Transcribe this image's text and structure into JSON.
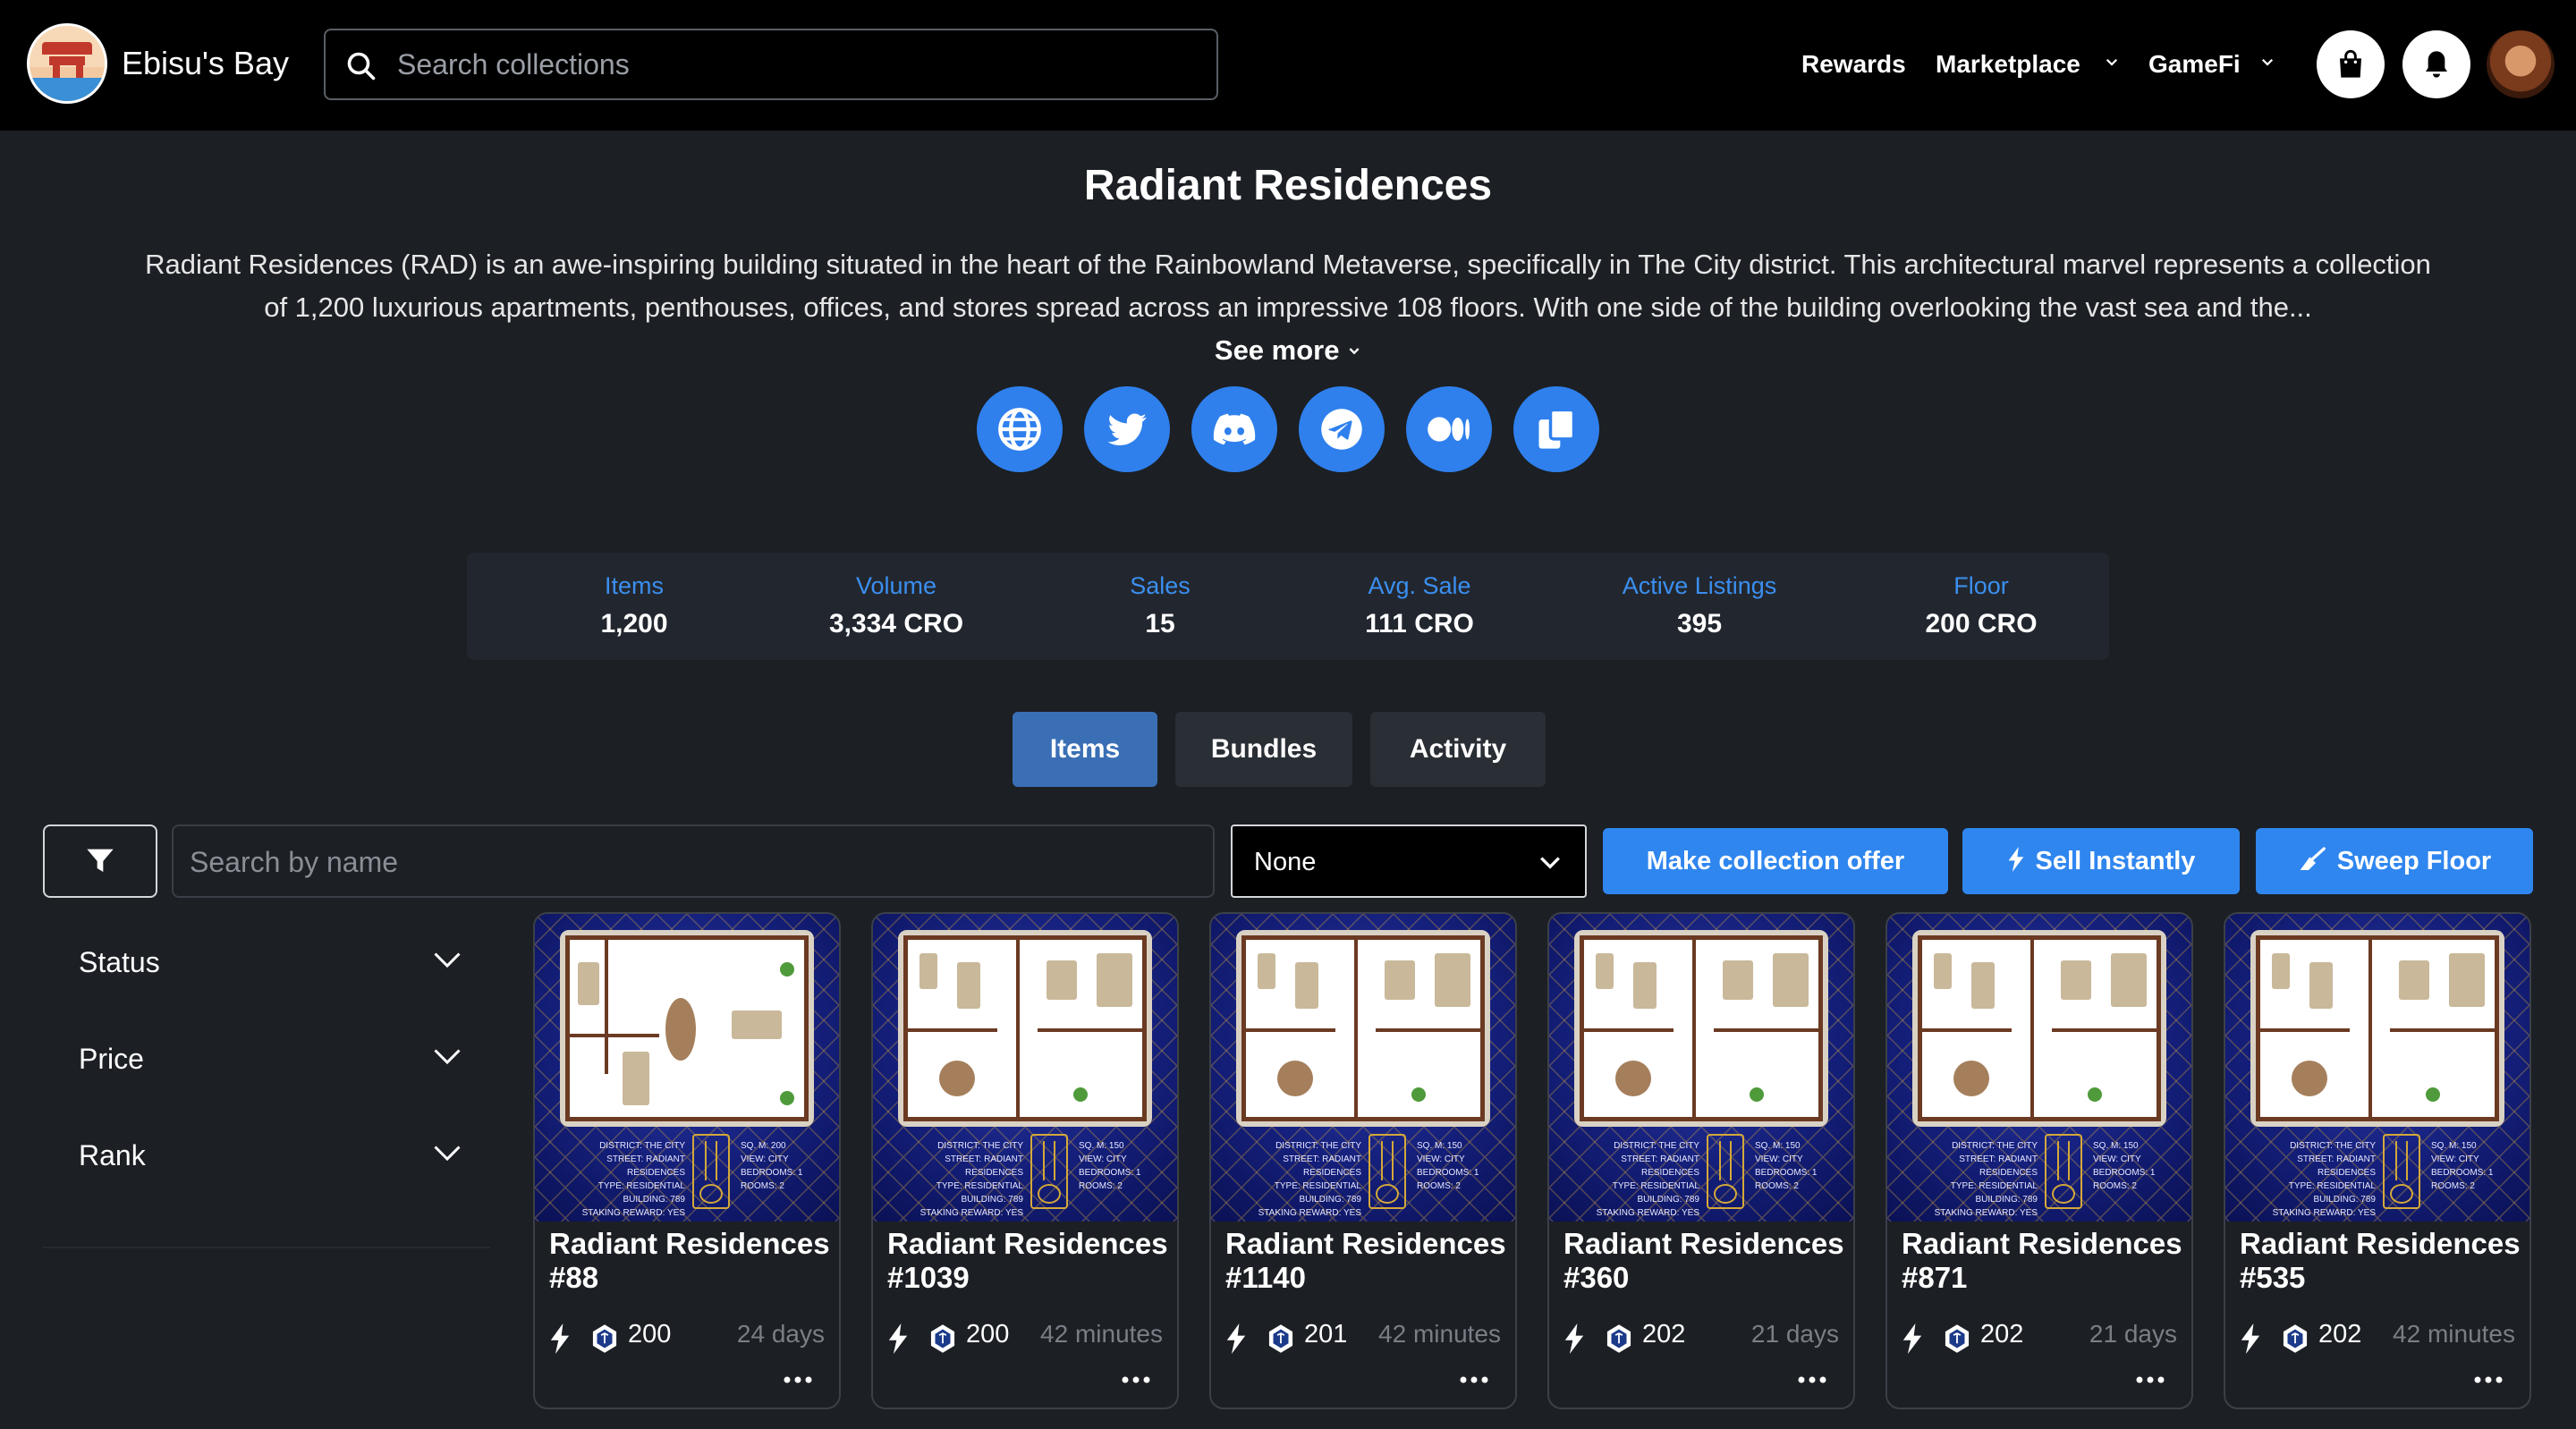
{
  "header": {
    "brand": "Ebisu's Bay",
    "search_placeholder": "Search collections",
    "nav": [
      "Rewards",
      "Marketplace",
      "GameFi"
    ]
  },
  "collection": {
    "title": "Radiant Residences",
    "description": "Radiant Residences (RAD) is an awe-inspiring building situated in the heart of the Rainbowland Metaverse, specifically in The City district. This architectural marvel represents a collection of 1,200 luxurious apartments, penthouses, offices, and stores spread across an impressive 108 floors. With one side of the building overlooking the vast sea and the...",
    "see_more": "See more",
    "socials": [
      "globe-icon",
      "twitter-icon",
      "discord-icon",
      "telegram-icon",
      "medium-icon",
      "copy-icon"
    ]
  },
  "stats": [
    {
      "label": "Items",
      "value": "1,200"
    },
    {
      "label": "Volume",
      "value": "3,334 CRO"
    },
    {
      "label": "Sales",
      "value": "15"
    },
    {
      "label": "Avg. Sale",
      "value": "111 CRO"
    },
    {
      "label": "Active Listings",
      "value": "395"
    },
    {
      "label": "Floor",
      "value": "200 CRO"
    }
  ],
  "tabs": [
    "Items",
    "Bundles",
    "Activity"
  ],
  "active_tab": "Items",
  "toolbar": {
    "name_search_placeholder": "Search by name",
    "sort_value": "None",
    "make_offer": "Make collection offer",
    "sell_instantly": "Sell Instantly",
    "sweep_floor": "Sweep Floor"
  },
  "filters": [
    "Status",
    "Price",
    "Rank"
  ],
  "card_art": {
    "info_left": [
      "DISTRICT: THE CITY",
      "STREET: RADIANT RESIDENCES",
      "TYPE: RESIDENTIAL",
      "BUILDING: 789",
      "STAKING REWARD: YES"
    ],
    "info_right_first": [
      "SQ. M: 200",
      "VIEW: CITY",
      "BEDROOMS: 1",
      "ROOMS: 2"
    ],
    "info_right": [
      "SQ. M: 150",
      "VIEW: CITY",
      "BEDROOMS: 1",
      "ROOMS: 2"
    ]
  },
  "cards": [
    {
      "name": "Radiant Residences #88",
      "price": "200",
      "time": "24 days"
    },
    {
      "name": "Radiant Residences #1039",
      "price": "200",
      "time": "42 minutes"
    },
    {
      "name": "Radiant Residences #1140",
      "price": "201",
      "time": "42 minutes"
    },
    {
      "name": "Radiant Residences #360",
      "price": "202",
      "time": "21 days"
    },
    {
      "name": "Radiant Residences #871",
      "price": "202",
      "time": "21 days"
    },
    {
      "name": "Radiant Residences #535",
      "price": "202",
      "time": "42 minutes"
    }
  ],
  "colors": {
    "accent": "#2f86ef",
    "stat_label": "#3b8ff0",
    "active_tab": "#3a6fb5",
    "background": "#1c1f24"
  }
}
